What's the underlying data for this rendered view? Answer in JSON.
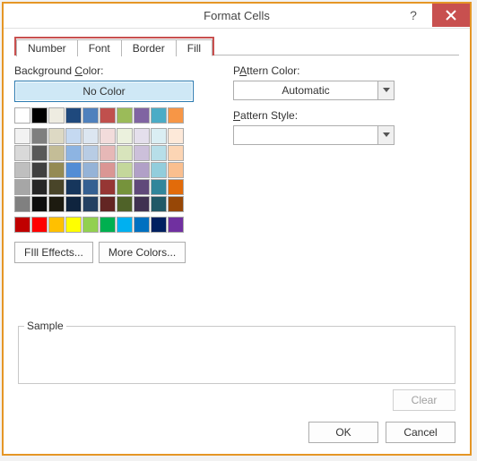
{
  "window": {
    "title": "Format Cells"
  },
  "tabs": {
    "number": "Number",
    "font": "Font",
    "border": "Border",
    "fill": "Fill",
    "active": "fill"
  },
  "left": {
    "bg_label": "Background Color:",
    "bg_u": "C",
    "no_color": "No Color",
    "fill_effects": "Fill Effects...",
    "more_colors": "More Colors...",
    "eff_u": "I",
    "mc_u": "M"
  },
  "right": {
    "pattern_color_label": "Pattern Color:",
    "pc_u": "A",
    "pattern_color_value": "Automatic",
    "pattern_style_label": "Pattern Style:",
    "ps_u": "P",
    "pattern_style_value": ""
  },
  "sample_label": "Sample",
  "buttons": {
    "clear": "Clear",
    "ok": "OK",
    "cancel": "Cancel"
  },
  "palette": {
    "row1": [
      "#ffffff",
      "#000000",
      "#eeece1",
      "#1f497d",
      "#4f81bd",
      "#c0504d",
      "#9bbb59",
      "#8064a2",
      "#4bacc6",
      "#f79646"
    ],
    "theme": [
      [
        "#f2f2f2",
        "#7f7f7f",
        "#ddd9c4",
        "#c5d9f1",
        "#dce6f1",
        "#f2dcdb",
        "#ebf1dd",
        "#e4dfec",
        "#daeef3",
        "#fde9d9"
      ],
      [
        "#d9d9d9",
        "#595959",
        "#c4bd97",
        "#8db4e2",
        "#b8cce4",
        "#e6b8b7",
        "#d8e4bc",
        "#ccc0da",
        "#b7dee8",
        "#fcd5b4"
      ],
      [
        "#bfbfbf",
        "#404040",
        "#948a54",
        "#538dd5",
        "#95b3d7",
        "#da9694",
        "#c4d79b",
        "#b1a0c7",
        "#92cddc",
        "#fabf8f"
      ],
      [
        "#a6a6a6",
        "#262626",
        "#494529",
        "#16365c",
        "#366092",
        "#963634",
        "#76933c",
        "#60497a",
        "#31869b",
        "#e26b0a"
      ],
      [
        "#808080",
        "#0d0d0d",
        "#1d1b10",
        "#0f243e",
        "#244062",
        "#632523",
        "#4f6228",
        "#403151",
        "#215967",
        "#974706"
      ]
    ],
    "standard": [
      "#c00000",
      "#ff0000",
      "#ffc000",
      "#ffff00",
      "#92d050",
      "#00b050",
      "#00b0f0",
      "#0070c0",
      "#002060",
      "#7030a0"
    ]
  }
}
